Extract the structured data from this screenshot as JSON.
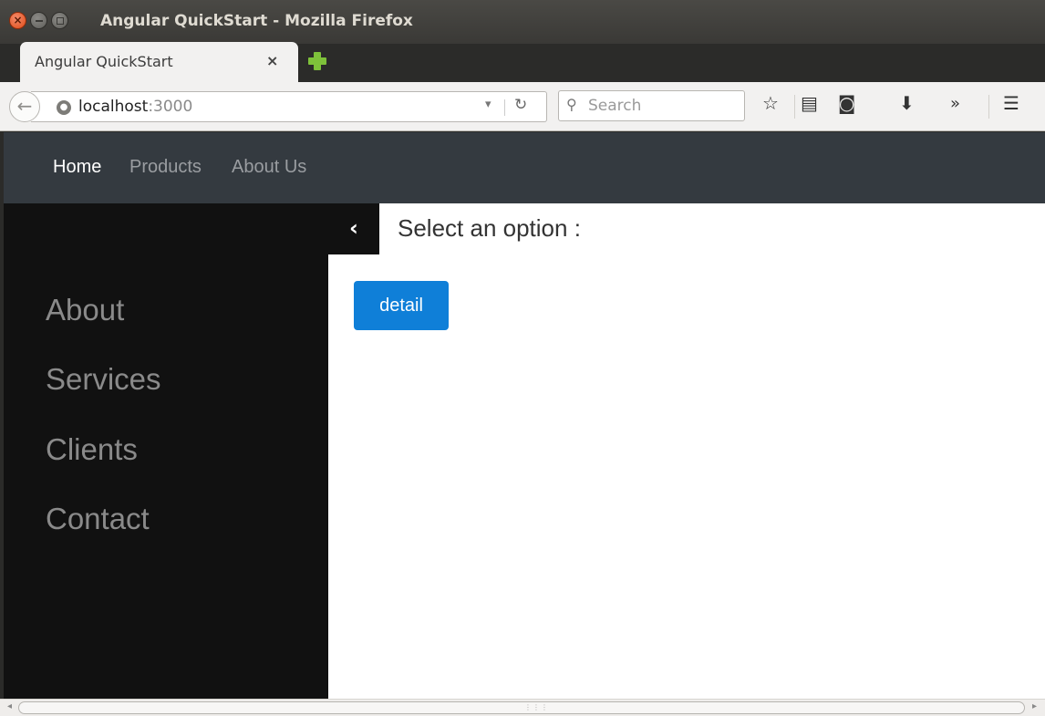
{
  "window": {
    "title": "Angular QuickStart - Mozilla Firefox"
  },
  "tab": {
    "label": "Angular QuickStart",
    "close": "×"
  },
  "toolbar": {
    "url_host": "localhost",
    "url_port": ":3000",
    "search_placeholder": "Search"
  },
  "navbar": {
    "links": [
      {
        "label": "Home",
        "active": true
      },
      {
        "label": "Products",
        "active": false
      },
      {
        "label": "About Us",
        "active": false
      }
    ]
  },
  "sidebar": {
    "items": [
      {
        "label": "About"
      },
      {
        "label": "Services"
      },
      {
        "label": "Clients"
      },
      {
        "label": "Contact"
      }
    ]
  },
  "main": {
    "toggle_icon": "chevron-left-icon",
    "title": "Select an option :",
    "detail_button": "detail"
  },
  "colors": {
    "navbar_bg": "#343a40",
    "sidebar_bg": "#111111",
    "button_bg": "#0f7fd8"
  }
}
